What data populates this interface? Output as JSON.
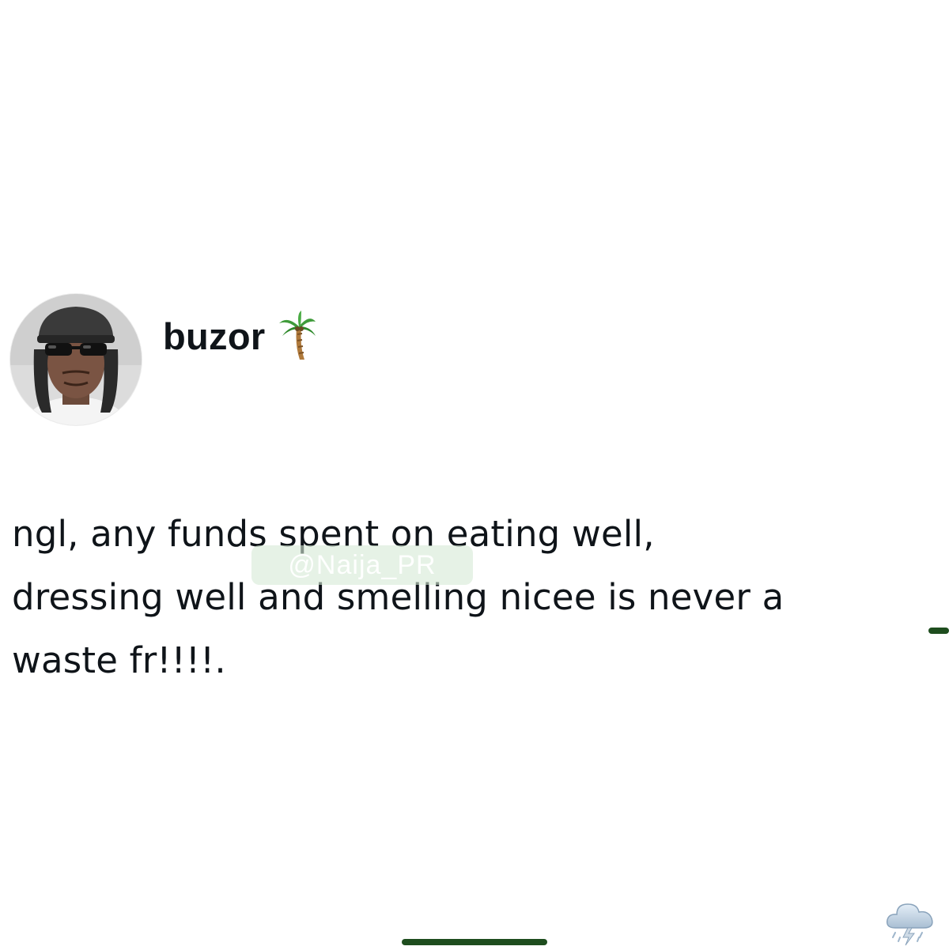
{
  "tweet": {
    "display_name": "buzor",
    "name_emoji": "palm-tree-icon",
    "avatar": "profile-photo",
    "text": "ngl, any funds spent on eating well,\ndressing well and smelling nicee is never a\nwaste fr!!!!."
  },
  "watermark": {
    "text": "@Naija_PR"
  },
  "icons": {
    "corner": "cloud-lightning-icon"
  },
  "colors": {
    "text": "#0f1419",
    "accent": "#1e4d1e",
    "background": "#ffffff"
  }
}
